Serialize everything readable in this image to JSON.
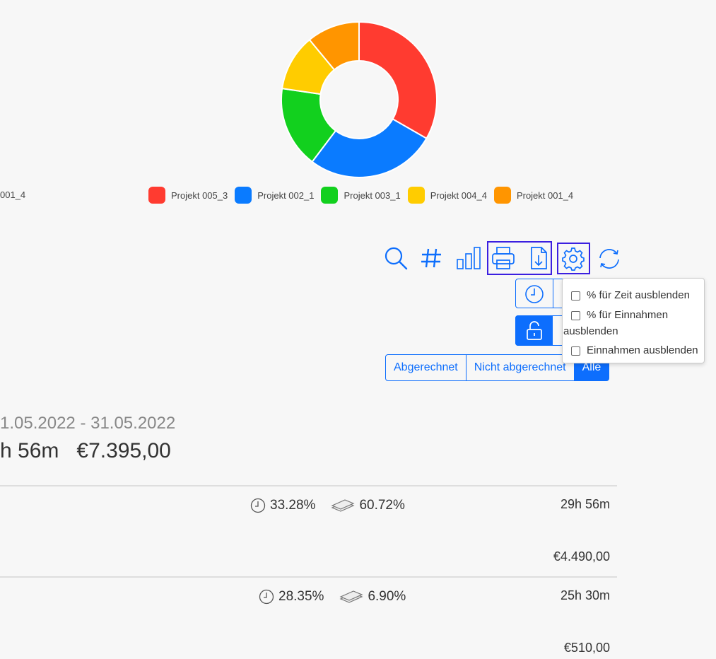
{
  "chart_data": {
    "type": "pie",
    "categories": [
      "Projekt 005_3",
      "Projekt 002_1",
      "Projekt 003_1",
      "Projekt 004_4",
      "Projekt 001_4"
    ],
    "values": [
      33.3,
      27.0,
      17.0,
      11.7,
      11.0
    ],
    "colors": [
      "#ff3b30",
      "#0a7bff",
      "#12d01e",
      "#ffcc00",
      "#ff9500"
    ],
    "legend_position": "bottom",
    "left_fragment": "001_4"
  },
  "toolbar": {
    "icons": [
      "search-icon",
      "hash-icon",
      "bar-chart-icon",
      "printer-icon",
      "file-download-icon",
      "gear-icon",
      "refresh-icon"
    ]
  },
  "settings_menu": {
    "items": [
      "% für Zeit ausblenden",
      "% für Einnahmen",
      "ausblenden",
      "Einnahmen ausblenden"
    ]
  },
  "filter": {
    "billed": "Abgerechnet",
    "unbilled": "Nicht abgerechnet",
    "all": "Alle"
  },
  "summary": {
    "date_range": "1.05.2022 - 31.05.2022",
    "total_time": "h 56m",
    "total_amount": "€7.395,00"
  },
  "rows": [
    {
      "time_pct": "33.28%",
      "money_pct": "60.72%",
      "time": "29h 56m",
      "amount": "€4.490,00"
    },
    {
      "time_pct": "28.35%",
      "money_pct": "6.90%",
      "time": "25h 30m",
      "amount": "€510,00"
    }
  ],
  "colors": {
    "accent": "#0d6efd",
    "highlight": "#3b1fe0"
  }
}
